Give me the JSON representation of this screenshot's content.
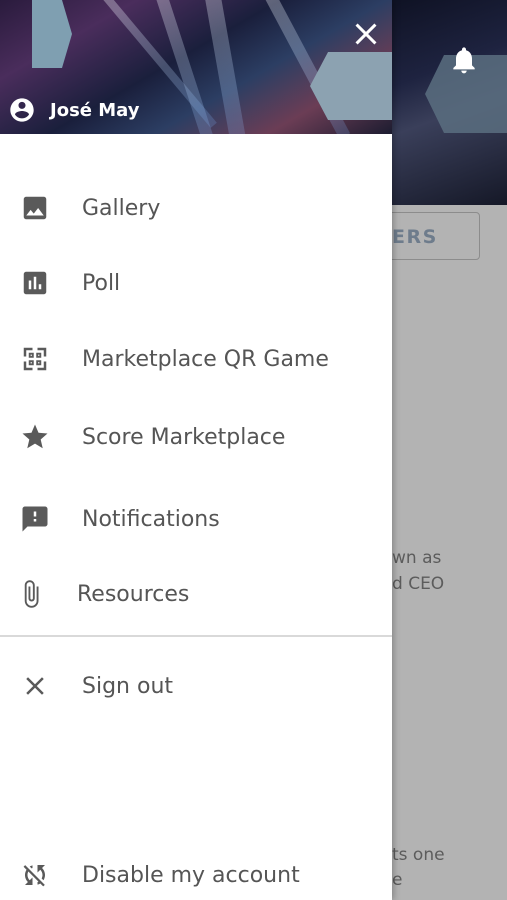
{
  "user": {
    "name": "José May"
  },
  "menu": {
    "items": [
      {
        "label": "Gallery",
        "icon": "image-icon"
      },
      {
        "label": "Poll",
        "icon": "poll-icon"
      },
      {
        "label": "Marketplace QR Game",
        "icon": "qr-scan-icon"
      },
      {
        "label": "Score Marketplace",
        "icon": "star-icon"
      },
      {
        "label": "Notifications",
        "icon": "feedback-icon"
      },
      {
        "label": "Resources",
        "icon": "paperclip-icon"
      }
    ],
    "sign_out": {
      "label": "Sign out",
      "icon": "close-icon"
    },
    "disable_account": {
      "label": "Disable my account",
      "icon": "sync-disabled-icon"
    }
  },
  "background": {
    "button_text": "ERS",
    "text_line_1": "wn as",
    "text_line_2": "d CEO",
    "text_line_3": "ts one",
    "text_line_4": "e"
  },
  "colors": {
    "overlay": "#b3b3b3",
    "drawer": "#ffffff",
    "icon": "#5a5a5a",
    "label": "#555555"
  }
}
